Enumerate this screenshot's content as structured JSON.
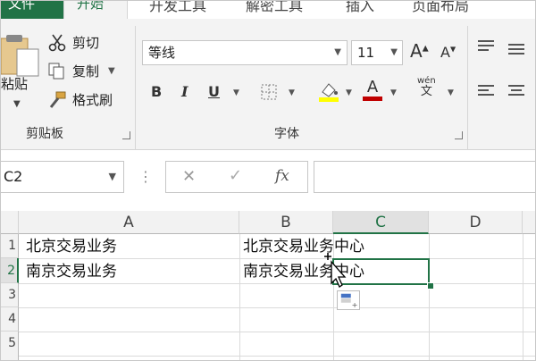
{
  "tabs": {
    "file": "文件",
    "home": "开始",
    "developer": "开发工具",
    "decrypt": "解密工具",
    "insert": "插入",
    "layout": "页面布局"
  },
  "clipboard": {
    "paste": "粘贴",
    "cut": "剪切",
    "copy": "复制",
    "format_painter": "格式刷",
    "group_label": "剪贴板"
  },
  "font": {
    "name": "等线",
    "size": "11",
    "bold": "B",
    "italic": "I",
    "underline": "U",
    "font_color_letter": "A",
    "grow": "A",
    "shrink": "A",
    "phonetic_top": "wén",
    "phonetic_bottom": "文",
    "group_label": "字体"
  },
  "formula_bar": {
    "name_box": "C2",
    "cancel": "✕",
    "enter": "✓",
    "fx": "fx",
    "value": ""
  },
  "grid": {
    "columns": [
      "A",
      "B",
      "C",
      "D"
    ],
    "active_column": "C",
    "rows": [
      "1",
      "2",
      "3",
      "4",
      "5"
    ],
    "active_row": "2",
    "cells": {
      "A1": "北京交易业务",
      "A2": "南京交易业务",
      "B1": "北京交易业务中心",
      "B2": "南京交易业务中心"
    }
  },
  "colors": {
    "accent": "#217346",
    "highlight": "#ffff00",
    "font_color": "#c00000"
  }
}
